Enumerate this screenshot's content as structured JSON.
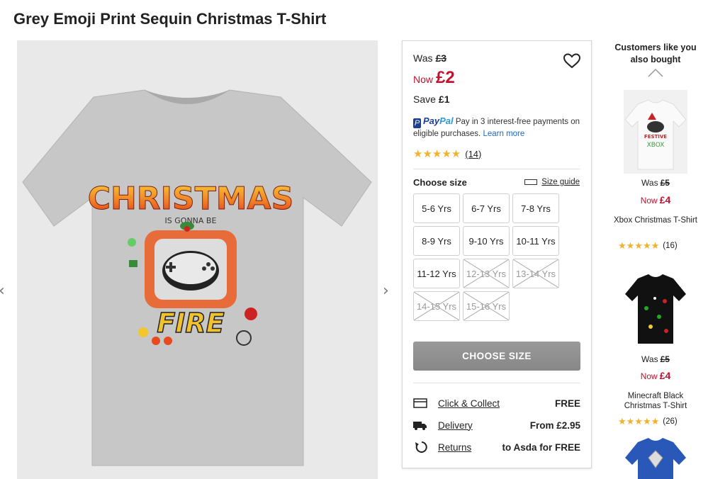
{
  "product": {
    "title": "Grey Emoji Print Sequin Christmas T-Shirt"
  },
  "pricing": {
    "was_label": "Was",
    "was_price": "£3",
    "now_label": "Now",
    "now_price": "£2",
    "save_label": "Save",
    "save_amount": "£1"
  },
  "paypal": {
    "logo_pay": "Pay",
    "logo_pal": "Pal",
    "text": "Pay in 3 interest-free payments on eligible purchases.",
    "learn_more": "Learn more"
  },
  "rating": {
    "stars": "★★★★★",
    "count": "(14)"
  },
  "size_selector": {
    "label": "Choose size",
    "guide_label": "Size guide",
    "sizes": [
      {
        "label": "5-6 Yrs",
        "available": true
      },
      {
        "label": "6-7 Yrs",
        "available": true
      },
      {
        "label": "7-8 Yrs",
        "available": true
      },
      {
        "label": "8-9 Yrs",
        "available": true
      },
      {
        "label": "9-10 Yrs",
        "available": true
      },
      {
        "label": "10-11 Yrs",
        "available": true
      },
      {
        "label": "11-12 Yrs",
        "available": true
      },
      {
        "label": "12-13 Yrs",
        "available": false
      },
      {
        "label": "13-14 Yrs",
        "available": false
      },
      {
        "label": "14-15 Yrs",
        "available": false
      },
      {
        "label": "15-16 Yrs",
        "available": false
      }
    ],
    "button_label": "CHOOSE SIZE"
  },
  "shipping": [
    {
      "icon": "store-icon",
      "label": "Click & Collect",
      "value": "FREE"
    },
    {
      "icon": "truck-icon",
      "label": "Delivery",
      "value": "From £2.95"
    },
    {
      "icon": "returns-icon",
      "label": "Returns",
      "value": "to Asda for FREE"
    }
  ],
  "recommendations": {
    "title": "Customers like you also bought",
    "items": [
      {
        "was_label": "Was",
        "was_price": "£5",
        "now_label": "Now",
        "now_price": "£4",
        "name": "Xbox Christmas T-Shirt",
        "stars": "★★★★★",
        "count": "(16)"
      },
      {
        "was_label": "Was",
        "was_price": "£5",
        "now_label": "Now",
        "now_price": "£4",
        "name": "Minecraft Black Christmas T-Shirt",
        "stars": "★★★★★",
        "count": "(26)"
      }
    ],
    "item1_graphic_text": "FESTIVE",
    "item1_graphic_text2": "XBOX"
  },
  "shirt_graphic": {
    "line1": "CHRISTMAS",
    "line2": "IS GONNA BE",
    "line3": "FIRE"
  },
  "colors": {
    "price_red": "#c8102e",
    "paypal_blue": "#1a3f93",
    "star_gold": "#f3b22b",
    "button_grey": "#8f8f8f"
  }
}
